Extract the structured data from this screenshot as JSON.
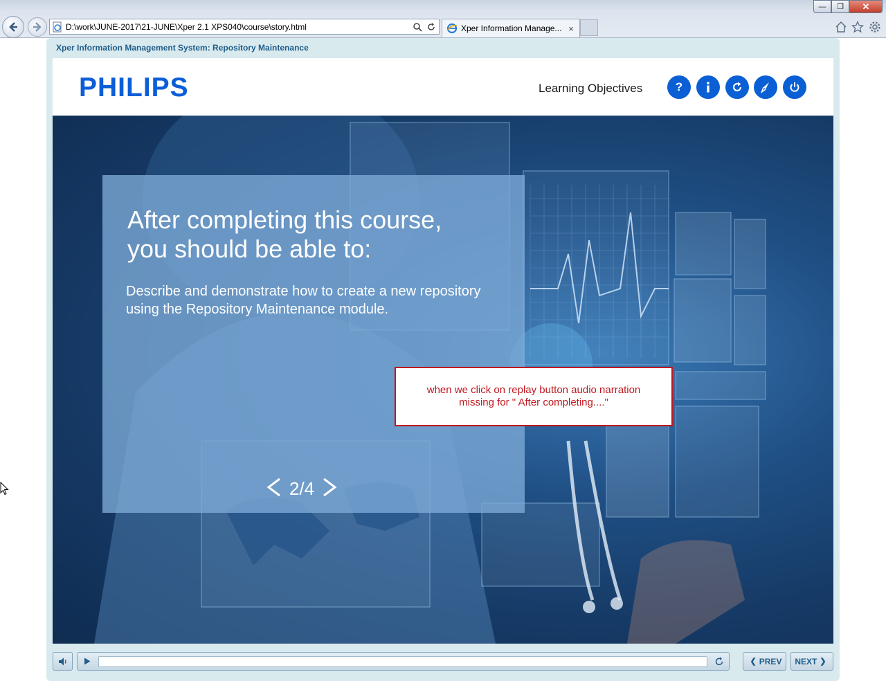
{
  "browser": {
    "address": "D:\\work\\JUNE-2017\\21-JUNE\\Xper 2.1 XPS040\\course\\story.html",
    "tab_title": "Xper Information Manage...",
    "tab_close": "×",
    "window_buttons": {
      "minimize": "—",
      "maximize": "❐",
      "close": "✕"
    }
  },
  "course": {
    "title": "Xper Information Management System: Repository Maintenance",
    "logo": "PHILIPS",
    "section_title": "Learning Objectives",
    "toolbar": [
      {
        "name": "help",
        "label": "?"
      },
      {
        "name": "info",
        "label": "i"
      },
      {
        "name": "replay",
        "icon": "replay-icon"
      },
      {
        "name": "glossary",
        "icon": "compass-icon"
      },
      {
        "name": "exit",
        "icon": "power-icon"
      }
    ]
  },
  "slide": {
    "heading": "After completing this course, you should be able to:",
    "objective": "Describe and demonstrate how to create a new repository using the Repository Maintenance module.",
    "page_counter": "2/4",
    "note": "when we click on replay button audio narration missing for \" After completing....\""
  },
  "controls": {
    "prev_label": "PREV",
    "next_label": "NEXT",
    "progress": 0
  },
  "colors": {
    "accent": "#0a5fd4",
    "note_border": "#c0181f",
    "course_title": "#1f5d8a"
  }
}
